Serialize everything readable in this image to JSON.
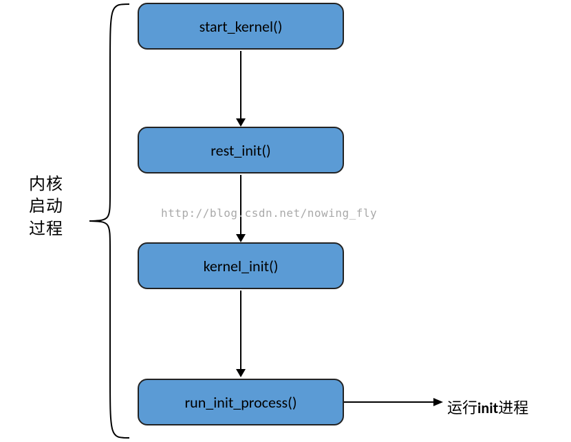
{
  "boxes": [
    {
      "label": "start_kernel()"
    },
    {
      "label": "rest_init()"
    },
    {
      "label": "kernel_init()"
    },
    {
      "label": "run_init_process()"
    }
  ],
  "sideLabel": {
    "line1": "内核",
    "line2": "启动",
    "line3": "过程"
  },
  "runLabel": {
    "prefix": "运行",
    "bold": "init",
    "suffix": "进程"
  },
  "watermark": "http://blog.csdn.net/nowing_fly",
  "colors": {
    "boxFill": "#5b9bd5",
    "boxStroke": "#222222",
    "arrow": "#000000",
    "watermark": "#a9a9a9"
  }
}
